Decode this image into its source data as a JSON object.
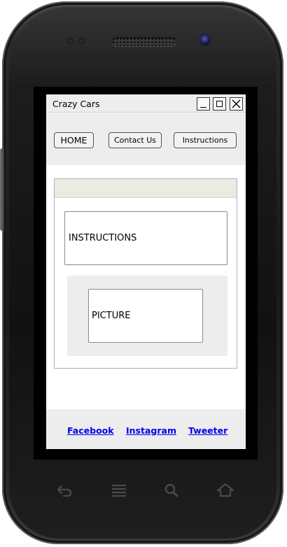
{
  "window": {
    "title": "Crazy Cars"
  },
  "nav": {
    "items": [
      {
        "label": "HOME"
      },
      {
        "label": "Contact Us"
      },
      {
        "label": "Instructions"
      }
    ]
  },
  "content": {
    "instructions_label": "INSTRUCTIONS",
    "picture_label": "PICTURE"
  },
  "footer": {
    "links": [
      {
        "label": "Facebook"
      },
      {
        "label": "Instagram"
      },
      {
        "label": "Tweeter"
      }
    ]
  },
  "colors": {
    "link": "#0000ee",
    "chrome_bg": "#ededed",
    "panel_header": "#ebebe1",
    "panel_border": "#9fb3c8",
    "phone_body": "#1a1a1a"
  },
  "icons": {
    "window_controls": [
      "minimize-icon",
      "maximize-icon",
      "close-icon"
    ],
    "device_keys": [
      "back-icon",
      "menu-icon",
      "search-icon",
      "home-icon"
    ]
  }
}
